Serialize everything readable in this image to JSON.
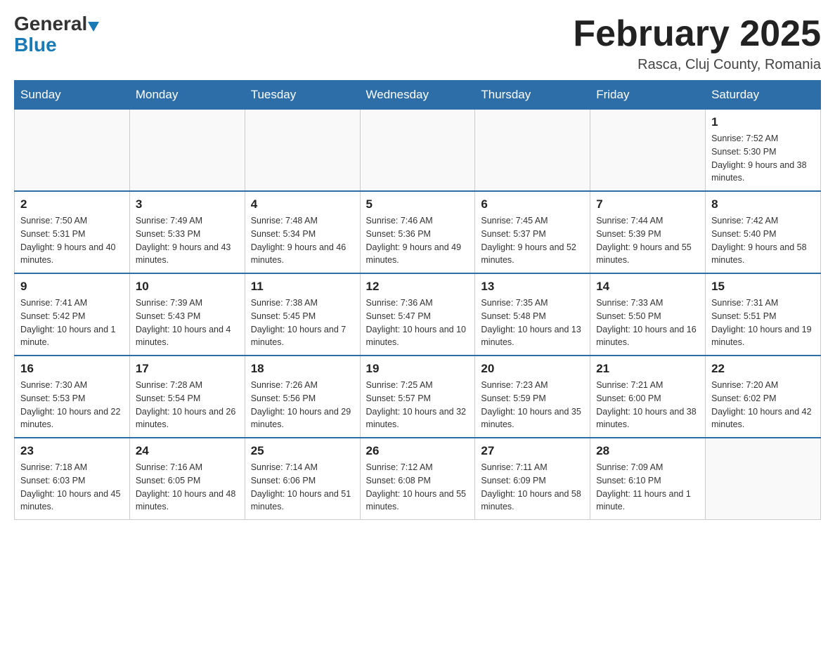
{
  "header": {
    "logo_general": "General",
    "logo_blue": "Blue",
    "month_title": "February 2025",
    "location": "Rasca, Cluj County, Romania"
  },
  "weekdays": [
    "Sunday",
    "Monday",
    "Tuesday",
    "Wednesday",
    "Thursday",
    "Friday",
    "Saturday"
  ],
  "weeks": [
    [
      {
        "day": "",
        "info": ""
      },
      {
        "day": "",
        "info": ""
      },
      {
        "day": "",
        "info": ""
      },
      {
        "day": "",
        "info": ""
      },
      {
        "day": "",
        "info": ""
      },
      {
        "day": "",
        "info": ""
      },
      {
        "day": "1",
        "info": "Sunrise: 7:52 AM\nSunset: 5:30 PM\nDaylight: 9 hours and 38 minutes."
      }
    ],
    [
      {
        "day": "2",
        "info": "Sunrise: 7:50 AM\nSunset: 5:31 PM\nDaylight: 9 hours and 40 minutes."
      },
      {
        "day": "3",
        "info": "Sunrise: 7:49 AM\nSunset: 5:33 PM\nDaylight: 9 hours and 43 minutes."
      },
      {
        "day": "4",
        "info": "Sunrise: 7:48 AM\nSunset: 5:34 PM\nDaylight: 9 hours and 46 minutes."
      },
      {
        "day": "5",
        "info": "Sunrise: 7:46 AM\nSunset: 5:36 PM\nDaylight: 9 hours and 49 minutes."
      },
      {
        "day": "6",
        "info": "Sunrise: 7:45 AM\nSunset: 5:37 PM\nDaylight: 9 hours and 52 minutes."
      },
      {
        "day": "7",
        "info": "Sunrise: 7:44 AM\nSunset: 5:39 PM\nDaylight: 9 hours and 55 minutes."
      },
      {
        "day": "8",
        "info": "Sunrise: 7:42 AM\nSunset: 5:40 PM\nDaylight: 9 hours and 58 minutes."
      }
    ],
    [
      {
        "day": "9",
        "info": "Sunrise: 7:41 AM\nSunset: 5:42 PM\nDaylight: 10 hours and 1 minute."
      },
      {
        "day": "10",
        "info": "Sunrise: 7:39 AM\nSunset: 5:43 PM\nDaylight: 10 hours and 4 minutes."
      },
      {
        "day": "11",
        "info": "Sunrise: 7:38 AM\nSunset: 5:45 PM\nDaylight: 10 hours and 7 minutes."
      },
      {
        "day": "12",
        "info": "Sunrise: 7:36 AM\nSunset: 5:47 PM\nDaylight: 10 hours and 10 minutes."
      },
      {
        "day": "13",
        "info": "Sunrise: 7:35 AM\nSunset: 5:48 PM\nDaylight: 10 hours and 13 minutes."
      },
      {
        "day": "14",
        "info": "Sunrise: 7:33 AM\nSunset: 5:50 PM\nDaylight: 10 hours and 16 minutes."
      },
      {
        "day": "15",
        "info": "Sunrise: 7:31 AM\nSunset: 5:51 PM\nDaylight: 10 hours and 19 minutes."
      }
    ],
    [
      {
        "day": "16",
        "info": "Sunrise: 7:30 AM\nSunset: 5:53 PM\nDaylight: 10 hours and 22 minutes."
      },
      {
        "day": "17",
        "info": "Sunrise: 7:28 AM\nSunset: 5:54 PM\nDaylight: 10 hours and 26 minutes."
      },
      {
        "day": "18",
        "info": "Sunrise: 7:26 AM\nSunset: 5:56 PM\nDaylight: 10 hours and 29 minutes."
      },
      {
        "day": "19",
        "info": "Sunrise: 7:25 AM\nSunset: 5:57 PM\nDaylight: 10 hours and 32 minutes."
      },
      {
        "day": "20",
        "info": "Sunrise: 7:23 AM\nSunset: 5:59 PM\nDaylight: 10 hours and 35 minutes."
      },
      {
        "day": "21",
        "info": "Sunrise: 7:21 AM\nSunset: 6:00 PM\nDaylight: 10 hours and 38 minutes."
      },
      {
        "day": "22",
        "info": "Sunrise: 7:20 AM\nSunset: 6:02 PM\nDaylight: 10 hours and 42 minutes."
      }
    ],
    [
      {
        "day": "23",
        "info": "Sunrise: 7:18 AM\nSunset: 6:03 PM\nDaylight: 10 hours and 45 minutes."
      },
      {
        "day": "24",
        "info": "Sunrise: 7:16 AM\nSunset: 6:05 PM\nDaylight: 10 hours and 48 minutes."
      },
      {
        "day": "25",
        "info": "Sunrise: 7:14 AM\nSunset: 6:06 PM\nDaylight: 10 hours and 51 minutes."
      },
      {
        "day": "26",
        "info": "Sunrise: 7:12 AM\nSunset: 6:08 PM\nDaylight: 10 hours and 55 minutes."
      },
      {
        "day": "27",
        "info": "Sunrise: 7:11 AM\nSunset: 6:09 PM\nDaylight: 10 hours and 58 minutes."
      },
      {
        "day": "28",
        "info": "Sunrise: 7:09 AM\nSunset: 6:10 PM\nDaylight: 11 hours and 1 minute."
      },
      {
        "day": "",
        "info": ""
      }
    ]
  ]
}
